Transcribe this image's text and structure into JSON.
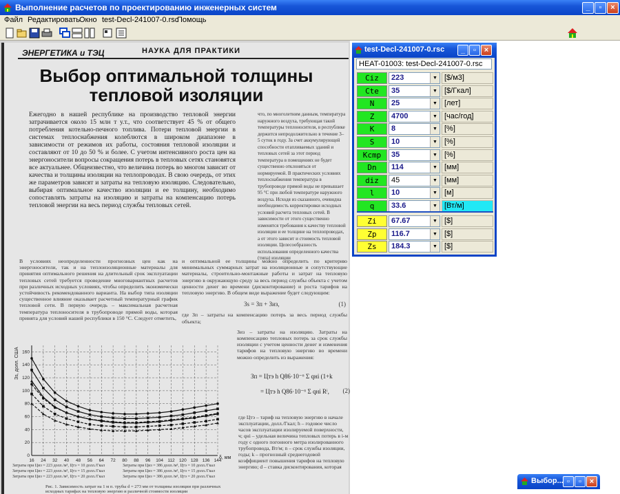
{
  "window": {
    "title": "Выполнение расчетов по проектированию инженерных систем",
    "minimize": "_",
    "maximize": "□",
    "close": "×"
  },
  "menu": [
    "Файл",
    "Редактировать",
    "Окно",
    "test-Decl-241007-0.rsc",
    "Помощь"
  ],
  "scan": {
    "header_left": "ЭНЕРГЕТИКА и ТЭЦ",
    "header_right": "НАУКА ДЛЯ ПРАКТИКИ",
    "title": "Выбор оптимальной толщины тепловой изоляции",
    "lead": "Ежегодно в нашей республике на производство тепловой энергии затрачивается около 15 млн т у.т., что соответствует 45 % от общего потребления котельно-печного топлива. Потери тепловой энергии в системах теплоснабжения колеблются в широком диапазоне в зависимости от режимов их работы, состояния тепловой изоляции и составляют от 10 до 50 % и более. С учетом интенсивного роста цен на энергоносители вопросы сокращения потерь в тепловых сетях становятся все актуальнее. Общеизвестно, что величина потерь во многом зависит от качества и толщины изоляции на теплопроводах. В свою очередь, от этих же параметров зависят и затраты на тепловую изоляцию. Следовательно, выбирая оптимальное качество изоляции и ее толщину, необходимо сопоставлять затраты на изоляцию и затраты на компенсацию потерь тепловой энергии на весь период службы тепловых сетей.",
    "col3": "что, по многолетним данным, температура наружного воздуха, требующая такой температуры теплоносителя, в республике держится непродолжительно в течение 3–5 суток в году. За счет аккумулирующей способности отапливаемых зданий и тепловых сетей за этот период температура в помещениях не будет существенно отклоняться от нормируемой. В практических условиях теплоснабжения температура в трубопроводе прямой воды не превышает 95 °С при любой температуре наружного воздуха. Исходя из сказанного, очевидна необходимость корректировки исходных условий расчета тепловых сетей. В зависимости от этого существенно изменятся требования к качеству тепловой изоляции и ее толщине на теплопроводах, а от этого зависит и стоимость тепловой изоляции. Целесообразность использования определенного качества (типа) изоляции",
    "body1": "В условиях неопределенности прогнозных цен как на энергоносители, так и на теплоизоляционные материалы для принятия оптимального решения на длительный срок эксплуатации тепловых сетей требуется проведение многовариантных расчетов при различных исходных условиях, чтобы определить экономически устойчивость рекомендованного варианта. На выбор типа изоляции существенное влияние оказывает расчетный температурный график тепловой сети. В первую очередь – максимальная расчетная температура теплоносителя в трубопроводе прямой воды, которая принята для условий нашей республики в 150 °С. Следует отметить,",
    "body2": "и оптимальной ее толщины можно определить по критерию минимальных суммарных затрат на изоляционные и сопутствующие материалы, строительно-монтажные работы и затрат на тепловую энергию в окружающую среду за весь период службы объекта с учетом ценности денег во времени (дисконтирование) и роста тарифов на тепловую энергию. В общем виде выражение будет следующим:",
    "formula1": "Зs = Зп + Зиз,",
    "formula1_num": "(1)",
    "body2b": "где Зп – затраты на компенсацию потерь за весь период службы объекта;",
    "body2c": "Зиз – затраты на изоляцию. Затраты на компенсацию тепловых потерь за срок службы изоляции с учетом ценности денег и изменения тарифов на тепловую энергию во времени можно определить из выражения:",
    "formula2_num": "(2)",
    "body3": "где Цтэ – тариф на тепловую энергию в начале эксплуатации, долл./Гкал; h – годовое число часов эксплуатации изолируемой поверхности, ч; qнi – удельная величина тепловых потерь в i-м году с одного погонного метра изолированного трубопровода, Вт/м; n – срок службы изоляции, годы; k – прогнозный среднегодовой коэффициент повышения тарифов на тепловую энергию; d – ставка дисконтирования, которая",
    "fig_caption": "Рис. 1. Зависимость затрат на 1 м п. трубы d = 273 мм от толщины изоляции при различных исходных тарифах на тепловую энергию и различной стоимости изоляции",
    "chart_ylabel": "Зs, долл. США",
    "chart_xlabel": "δ, мм",
    "legend": [
      "Затраты при Циз = 223 долл./м³, Цтэ = 10 долл./Гкал",
      "Затраты при Циз = 223 долл./м³, Цтэ = 15 долл./Гкал",
      "Затраты при Циз = 223 долл./м³, Цтэ = 20 долл./Гкал",
      "Затраты при Циз = 386 долл./м³, Цтэ = 10 долл./Гкал",
      "Затраты при Циз = 386 долл./м³, Цтэ = 15 долл./Гкал",
      "Затраты при Циз = 386 долл./м³, Цтэ = 20 долл./Гкал"
    ]
  },
  "chart_data": {
    "type": "line",
    "x": [
      16,
      24,
      32,
      40,
      48,
      56,
      64,
      72,
      80,
      88,
      96,
      104,
      112,
      120,
      128,
      136,
      144
    ],
    "xticks": [
      16,
      24,
      32,
      40,
      48,
      56,
      64,
      72,
      80,
      88,
      96,
      104,
      112,
      120,
      128,
      136,
      144
    ],
    "yticks": [
      0,
      20,
      40,
      60,
      80,
      100,
      120,
      140,
      160
    ],
    "xlim": [
      16,
      144
    ],
    "ylim": [
      0,
      170
    ],
    "grid": true,
    "series": [
      {
        "values": [
          150,
          118,
          97,
          84,
          76,
          70,
          67,
          65,
          64,
          64,
          65,
          66,
          68,
          71,
          74,
          77,
          80
        ]
      },
      {
        "values": [
          132,
          104,
          86,
          75,
          68,
          63,
          60,
          58,
          57,
          57,
          58,
          59,
          61,
          63,
          66,
          69,
          72
        ]
      },
      {
        "values": [
          115,
          90,
          75,
          66,
          60,
          56,
          53,
          51,
          50,
          50,
          51,
          52,
          54,
          56,
          58,
          61,
          64
        ]
      },
      {
        "values": [
          110,
          88,
          74,
          66,
          60,
          56,
          54,
          52,
          51,
          51,
          52,
          53,
          55,
          57,
          59,
          62,
          65
        ]
      },
      {
        "values": [
          95,
          76,
          64,
          57,
          52,
          48,
          46,
          45,
          44,
          44,
          45,
          46,
          47,
          49,
          51,
          53,
          56
        ]
      },
      {
        "values": [
          80,
          64,
          54,
          48,
          44,
          41,
          39,
          38,
          38,
          38,
          39,
          40,
          41,
          43,
          45,
          47,
          50
        ]
      }
    ]
  },
  "child": {
    "title": "test-Decl-241007-0.rsc",
    "header": "HEAT-01003:  test-Decl-241007-0.rsc",
    "inputs": [
      {
        "label": "Ciz",
        "value": "223",
        "unit": "[$/м3]"
      },
      {
        "label": "Cte",
        "value": "35",
        "unit": "[$/Гкал]"
      },
      {
        "label": "N",
        "value": "25",
        "unit": "[лет]"
      },
      {
        "label": "Z",
        "value": "4700",
        "unit": "[час/год]"
      },
      {
        "label": "K",
        "value": "8",
        "unit": "[%]"
      },
      {
        "label": "S",
        "value": "10",
        "unit": "[%]"
      },
      {
        "label": "Kcmp",
        "value": "35",
        "unit": "[%]"
      },
      {
        "label": "Dn",
        "value": "114",
        "unit": "[мм]"
      },
      {
        "label": "diz",
        "value": "45",
        "unit": "[мм]"
      },
      {
        "label": "l",
        "value": "10",
        "unit": "[м]"
      },
      {
        "label": "q",
        "value": "33.6",
        "unit": "[Вт/м]"
      }
    ],
    "outputs": [
      {
        "label": "Zi",
        "value": "67.67",
        "unit": "[$]"
      },
      {
        "label": "Zp",
        "value": "116.7",
        "unit": "[$]"
      },
      {
        "label": "Zs",
        "value": "184.3",
        "unit": "[$]"
      }
    ],
    "accent_colors": {
      "label_green": "#22e622",
      "label_yellow": "#ffff33",
      "highlight_cyan": "#22e8f5"
    }
  },
  "minimized": {
    "title": "Выбор..."
  }
}
